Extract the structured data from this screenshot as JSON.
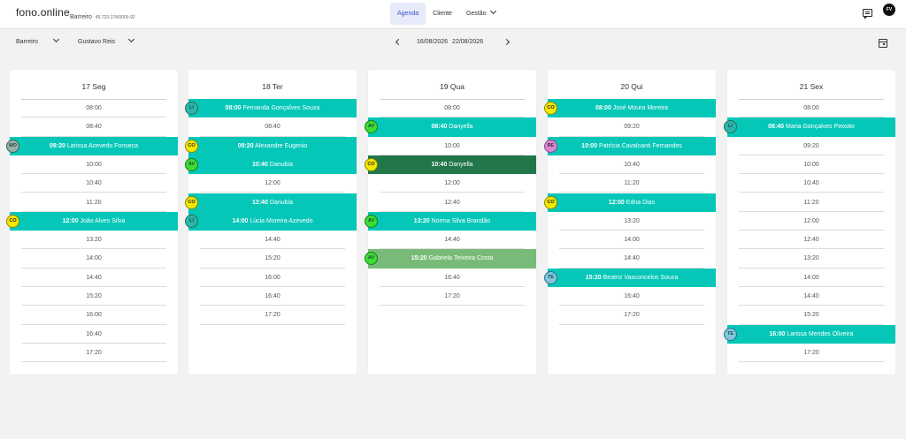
{
  "header": {
    "logo": "fono.online",
    "company": "Barreiro",
    "cnpj": "45.723.174/0000-92",
    "nav": [
      {
        "label": "Agenda",
        "active": true
      },
      {
        "label": "Cliente",
        "active": false
      },
      {
        "label": "Gestão",
        "active": false
      }
    ],
    "chat_icon": "chat-icon",
    "avatar_initials": "FV"
  },
  "toolbar": {
    "location": "Barreiro",
    "professional": "Gustavo Reis",
    "date_start": "16/08/2026",
    "date_end": "22/08/2026",
    "calendar_icon": "calendar-icon"
  },
  "colors": {
    "appointment": "#05c7b8",
    "appointment_dark": "#21774a",
    "appointment_light": "#78bb78",
    "nav_active": "#3b57c9",
    "badge_yellow": "#f5e800",
    "badge_green": "#3ddc33"
  },
  "days": [
    {
      "title": "17 Seg",
      "slots": [
        {
          "time": "08:00"
        },
        {
          "time": "08:40"
        },
        {
          "time": "09:20",
          "patient": "Larissa Azevedo Fonseca",
          "badge": "MO",
          "badge_color": "gray"
        },
        {
          "time": "10:00"
        },
        {
          "time": "10:40"
        },
        {
          "time": "11:20"
        },
        {
          "time": "12:00",
          "patient": "João Alves Silva",
          "badge": "CO",
          "badge_color": "yellow"
        },
        {
          "time": "13:20"
        },
        {
          "time": "14:00"
        },
        {
          "time": "14:40"
        },
        {
          "time": "15:20"
        },
        {
          "time": "16:00"
        },
        {
          "time": "16:40"
        },
        {
          "time": "17:20"
        }
      ]
    },
    {
      "title": "18 Ter",
      "slots": [
        {
          "time": "08:00",
          "patient": "Fernanda Gonçalves Souza",
          "badge": "LI",
          "badge_color": "teal"
        },
        {
          "time": "08:40"
        },
        {
          "time": "09:20",
          "patient": "Alexandre Eugenio",
          "badge": "CO",
          "badge_color": "yellow"
        },
        {
          "time": "10:40",
          "patient": "Danubia",
          "badge": "AV",
          "badge_color": "green"
        },
        {
          "time": "12:00"
        },
        {
          "time": "12:40",
          "patient": "Danubia",
          "badge": "CO",
          "badge_color": "yellow"
        },
        {
          "time": "14:00",
          "patient": "Lúcia Moreira Azevedo",
          "badge": "LI",
          "badge_color": "teal"
        },
        {
          "time": "14:40"
        },
        {
          "time": "15:20"
        },
        {
          "time": "16:00"
        },
        {
          "time": "16:40"
        },
        {
          "time": "17:20"
        }
      ]
    },
    {
      "title": "19 Qua",
      "slots": [
        {
          "time": "08:00"
        },
        {
          "time": "08:40",
          "patient": "Danyella",
          "badge": "AV",
          "badge_color": "green"
        },
        {
          "time": "10:00"
        },
        {
          "time": "10:40",
          "patient": "Danyella",
          "badge": "CO",
          "badge_color": "yellow",
          "variant": "dark"
        },
        {
          "time": "12:00"
        },
        {
          "time": "12:40"
        },
        {
          "time": "13:20",
          "patient": "Norma Silva Brandão",
          "badge": "AV",
          "badge_color": "green"
        },
        {
          "time": "14:40"
        },
        {
          "time": "15:20",
          "patient": "Gabriela Teixeira Costa",
          "badge": "AV",
          "badge_color": "green",
          "variant": "light"
        },
        {
          "time": "16:40"
        },
        {
          "time": "17:20"
        }
      ]
    },
    {
      "title": "20 Qui",
      "slots": [
        {
          "time": "08:00",
          "patient": "José Moura Moreira",
          "badge": "CO",
          "badge_color": "yellow"
        },
        {
          "time": "09:20"
        },
        {
          "time": "10:00",
          "patient": "Patrícia Cavalcanti Fernandes",
          "badge": "RE",
          "badge_color": "pink"
        },
        {
          "time": "10:40"
        },
        {
          "time": "11:20"
        },
        {
          "time": "12:00",
          "patient": "Edna Dias",
          "badge": "CO",
          "badge_color": "yellow"
        },
        {
          "time": "13:20"
        },
        {
          "time": "14:00"
        },
        {
          "time": "14:40"
        },
        {
          "time": "15:20",
          "patient": "Beatriz Vasconcelos Souza",
          "badge": "TE",
          "badge_color": "lightblue"
        },
        {
          "time": "16:40"
        },
        {
          "time": "17:20"
        }
      ]
    },
    {
      "title": "21 Sex",
      "slots": [
        {
          "time": "08:00"
        },
        {
          "time": "08:40",
          "patient": "Maria Gonçalves Peixoto",
          "badge": "LI",
          "badge_color": "teal"
        },
        {
          "time": "09:20"
        },
        {
          "time": "10:00"
        },
        {
          "time": "10:40"
        },
        {
          "time": "11:20"
        },
        {
          "time": "12:00"
        },
        {
          "time": "12:40"
        },
        {
          "time": "13:20"
        },
        {
          "time": "14:00"
        },
        {
          "time": "14:40"
        },
        {
          "time": "15:20"
        },
        {
          "time": "16:00",
          "patient": "Larissa Mendes Oliveira",
          "badge": "TE",
          "badge_color": "lightblue"
        },
        {
          "time": "17:20"
        }
      ]
    }
  ]
}
